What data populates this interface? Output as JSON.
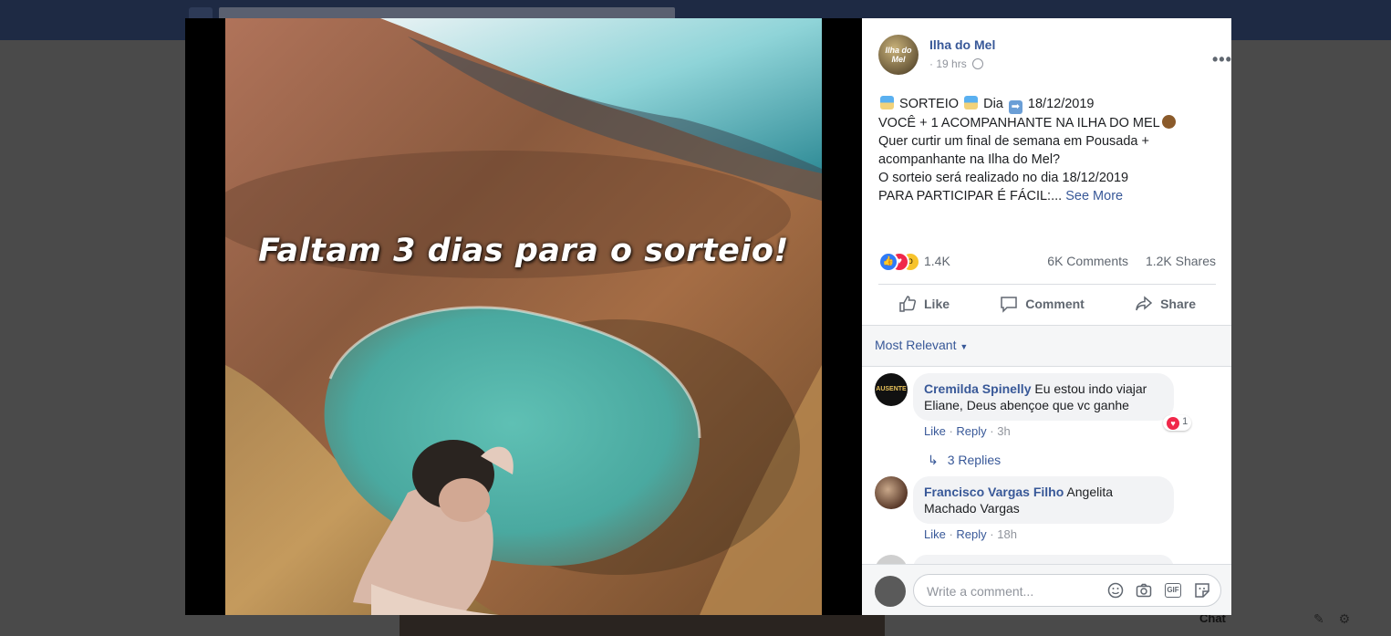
{
  "post": {
    "page_name": "Ilha do Mel",
    "avatar_text": "Ilha do Mel",
    "time": "19 hrs",
    "dot": "·",
    "text_lines": [
      {
        "pre": "",
        "mid": "SORTEIO",
        "mid2": "Dia",
        "post": "18/12/2019"
      },
      {
        "text": "VOCÊ + 1 ACOMPANHANTE NA ILHA DO MEL"
      },
      {
        "text": "Quer curtir um final de semana em Pousada +"
      },
      {
        "text": "acompanhante na Ilha do Mel?"
      },
      {
        "text": "O sorteio será realizado no dia 18/12/2019"
      },
      {
        "text": "PARA PARTICIPAR É FÁCIL:..."
      }
    ],
    "see_more": "See More",
    "image_caption": "Faltam 3 dias para o sorteio!"
  },
  "stats": {
    "reactions": "1.4K",
    "comments": "6K Comments",
    "shares": "1.2K Shares"
  },
  "actions": {
    "like": "Like",
    "comment": "Comment",
    "share": "Share"
  },
  "comments_section": {
    "sort": "Most Relevant",
    "items": [
      {
        "author": "Cremilda Spinelly",
        "avatar_text": "AUSENTE",
        "text": "Eu estou indo viajar Eliane, Deus abençoe que vc ganhe",
        "like": "Like",
        "reply": "Reply",
        "time": "3h",
        "reaction_count": "1"
      },
      {
        "author": "Francisco Vargas Filho",
        "text": "Angelita Machado Vargas",
        "like": "Like",
        "reply": "Reply",
        "time": "18h"
      }
    ],
    "replies_link": "3 Replies"
  },
  "composer": {
    "placeholder": "Write a comment..."
  },
  "background": {
    "chat_label": "Chat"
  },
  "colors": {
    "link": "#385898",
    "like_blue": "#2f7bf6",
    "love_red": "#f0284a"
  }
}
